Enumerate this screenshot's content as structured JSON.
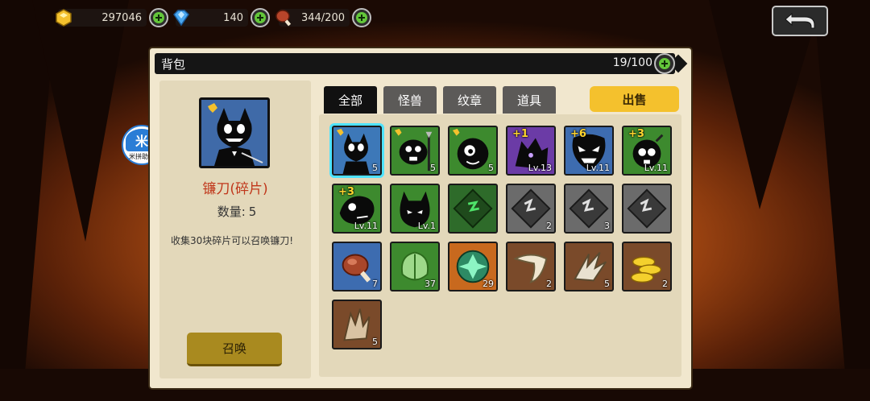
{
  "resources": {
    "gold": {
      "icon": "gold-gem-icon",
      "value": "297046"
    },
    "diamond": {
      "icon": "blue-diamond-icon",
      "value": "140"
    },
    "meat": {
      "icon": "meat-drumstick-icon",
      "value": "344/200"
    }
  },
  "back_button": {
    "icon": "return-arrow-icon"
  },
  "panel": {
    "title": "背包",
    "capacity": "19/100"
  },
  "detail": {
    "name": "镰刀(碎片)",
    "quantity_label": "数量:",
    "quantity_value": "5",
    "description": "收集30块碎片可以召唤镰刀!",
    "summon_label": "召唤"
  },
  "floating_badge": {
    "glyph": "米",
    "caption": "米拼助手"
  },
  "tabs": [
    "全部",
    "怪兽",
    "纹章",
    "道具"
  ],
  "sell_label": "出售",
  "items": [
    {
      "kind": "monster-shard",
      "bg": "#3d78b8",
      "count": "5",
      "selected": true,
      "icon": "cat-bat-fragment-icon"
    },
    {
      "kind": "monster-shard",
      "bg": "#3d8a2e",
      "count": "5",
      "icon": "pig-warrior-fragment-icon"
    },
    {
      "kind": "monster-shard",
      "bg": "#3d8a2e",
      "count": "5",
      "icon": "round-monster-fragment-icon"
    },
    {
      "kind": "monster",
      "bg": "#6b3ba6",
      "plus": "+1",
      "level": "Lv.13",
      "icon": "wolf-monster-icon"
    },
    {
      "kind": "monster",
      "bg": "#3d6cb0",
      "plus": "+6",
      "level": "Lv.11",
      "icon": "venom-monster-icon"
    },
    {
      "kind": "monster",
      "bg": "#3d8a2e",
      "plus": "+3",
      "level": "Lv.11",
      "icon": "skull-bomb-monster-icon"
    },
    {
      "kind": "monster",
      "bg": "#3d8a2e",
      "plus": "+3",
      "level": "Lv.11",
      "icon": "dino-monster-icon"
    },
    {
      "kind": "monster",
      "bg": "#3d8a2e",
      "level": "Lv.1",
      "icon": "horned-blob-monster-icon"
    },
    {
      "kind": "emblem",
      "bg": "#2e6b2a",
      "icon": "green-emblem-icon"
    },
    {
      "kind": "emblem",
      "bg": "#6b6b6b",
      "count": "2",
      "icon": "gray-emblem-icon"
    },
    {
      "kind": "emblem",
      "bg": "#6b6b6b",
      "count": "3",
      "icon": "gray-emblem-icon"
    },
    {
      "kind": "emblem",
      "bg": "#6b6b6b",
      "icon": "gray-emblem-icon"
    },
    {
      "kind": "item",
      "bg": "#3d6cb0",
      "count": "7",
      "icon": "meat-icon"
    },
    {
      "kind": "item",
      "bg": "#3d8a2e",
      "count": "37",
      "icon": "cabbage-icon"
    },
    {
      "kind": "item",
      "bg": "#c8691e",
      "count": "29",
      "icon": "green-orb-icon"
    },
    {
      "kind": "item",
      "bg": "#7a4a2a",
      "count": "2",
      "icon": "fang-icon"
    },
    {
      "kind": "item",
      "bg": "#7a4a2a",
      "count": "5",
      "icon": "claw-icon"
    },
    {
      "kind": "item",
      "bg": "#7a4a2a",
      "count": "2",
      "icon": "gold-coins-icon"
    },
    {
      "kind": "item",
      "bg": "#7a4a2a",
      "count": "5",
      "icon": "feather-claw-icon"
    }
  ]
}
